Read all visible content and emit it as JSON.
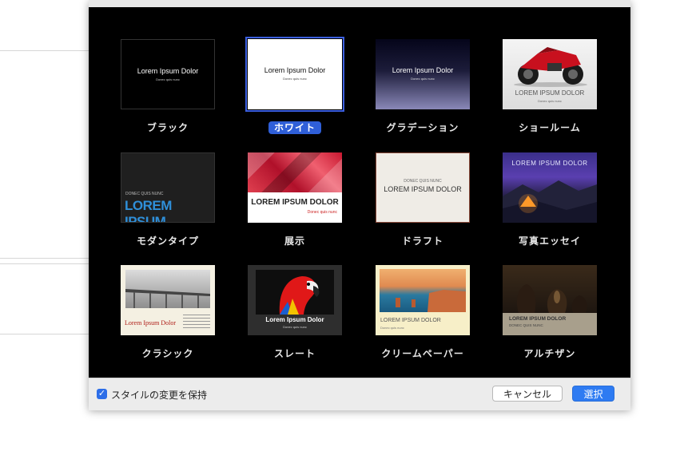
{
  "dialog": {
    "themes": [
      {
        "label": "ブラック",
        "preview_title": "Lorem Ipsum Dolor",
        "preview_subtitle": "Donec quis nunc"
      },
      {
        "label": "ホワイト",
        "preview_title": "Lorem Ipsum Dolor",
        "preview_subtitle": "Donec quis nunc",
        "selected": true
      },
      {
        "label": "グラデーション",
        "preview_title": "Lorem Ipsum Dolor",
        "preview_subtitle": "Donec quis nunc"
      },
      {
        "label": "ショールーム",
        "preview_title": "LOREM IPSUM DOLOR",
        "preview_subtitle": "Donec quis nunc"
      },
      {
        "label": "モダンタイプ",
        "preview_kicker": "DONEC QUIS NUNC",
        "preview_title": "LOREM IPSUM"
      },
      {
        "label": "展示",
        "preview_title": "LOREM IPSUM DOLOR",
        "preview_subtitle": "Donec quis nunc"
      },
      {
        "label": "ドラフト",
        "preview_kicker": "DONEC QUIS NUNC",
        "preview_title": "LOREM IPSUM DOLOR"
      },
      {
        "label": "写真エッセイ",
        "preview_title": "LOREM IPSUM DOLOR"
      },
      {
        "label": "クラシック",
        "preview_title": "Lorem Ipsum Dolor"
      },
      {
        "label": "スレート",
        "preview_title": "Lorem Ipsum Dolor",
        "preview_subtitle": "Donec quis nunc"
      },
      {
        "label": "クリームペーパー",
        "preview_title": "LOREM IPSUM DOLOR",
        "preview_subtitle": "Donec quis nunc"
      },
      {
        "label": "アルチザン",
        "preview_title": "LOREM IPSUM DOLOR",
        "preview_subtitle": "DONEC QUIS NUNC"
      }
    ]
  },
  "footer": {
    "checkbox_label": "スタイルの変更を保持",
    "checkbox_checked": true,
    "cancel_label": "キャンセル",
    "select_label": "選択"
  },
  "colors": {
    "accent": "#2e7bf2",
    "selection": "#2f5fd8"
  }
}
